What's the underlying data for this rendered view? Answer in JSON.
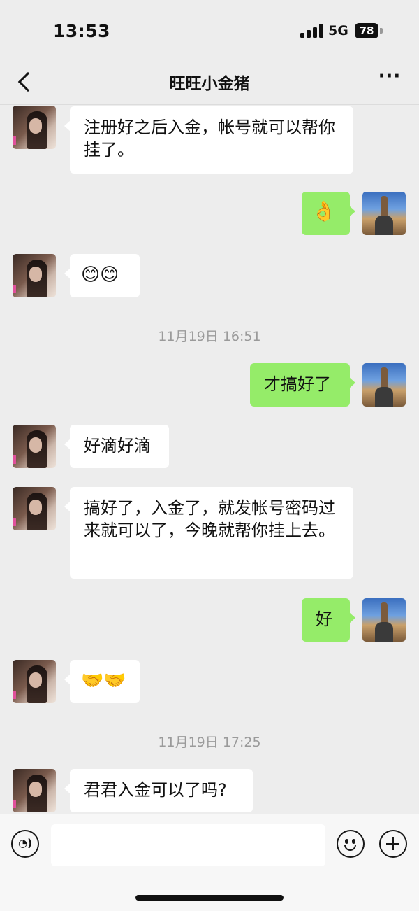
{
  "status_bar": {
    "time": "13:53",
    "network": "5G",
    "battery": "78"
  },
  "header": {
    "title": "旺旺小金猪",
    "more_label": "···"
  },
  "messages": [
    {
      "text": "注册好之后入金，帐号就可以帮你挂了。"
    },
    {
      "text": "👌"
    },
    {
      "text": "😊😊"
    },
    {
      "text": "11月19日 16:51"
    },
    {
      "text": "才搞好了"
    },
    {
      "text": "好滴好滴"
    },
    {
      "text": "搞好了，入金了，就发帐号密码过来就可以了，今晚就帮你挂上去。"
    },
    {
      "text": "好"
    },
    {
      "text": "🤝🤝"
    },
    {
      "text": "11月19日 17:25"
    },
    {
      "text": "君君入金可以了吗?"
    }
  ],
  "input_bar": {
    "voice_icon": "voice-icon",
    "emoji_icon": "emoji-icon",
    "plus_icon": "plus-icon",
    "voice_glyph": "◔)"
  },
  "colors": {
    "background": "#ededed",
    "incoming_bubble": "#ffffff",
    "outgoing_bubble": "#95ec69",
    "timestamp": "#9a9a9a"
  }
}
